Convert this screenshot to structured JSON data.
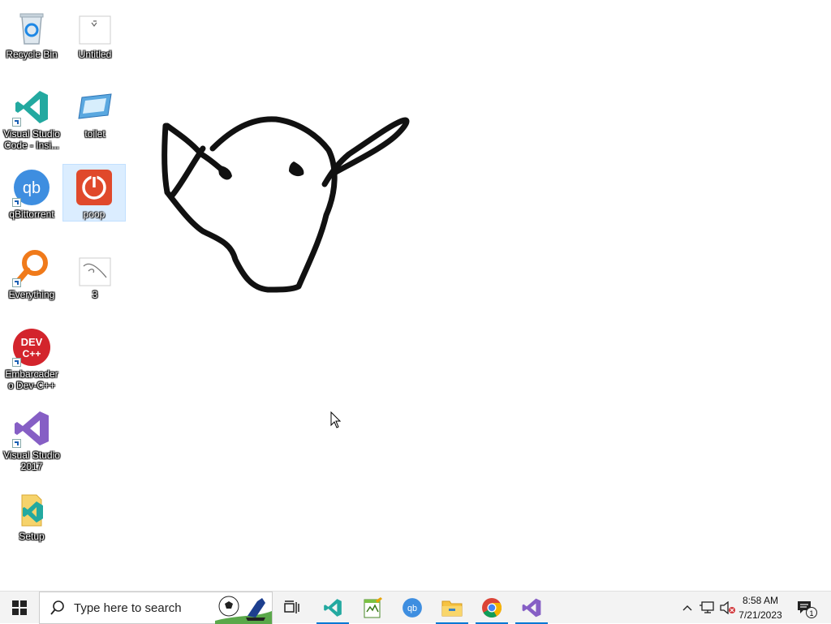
{
  "desktop": {
    "icons": [
      {
        "label": "Recycle Bin"
      },
      {
        "label": "Untitled"
      },
      {
        "label": "Visual Studio Code - Insi..."
      },
      {
        "label": "toilet"
      },
      {
        "label": "qBittorrent"
      },
      {
        "label": "poop"
      },
      {
        "label": "Everything"
      },
      {
        "label": "3"
      },
      {
        "label": "Embarcadero Dev-C++"
      },
      {
        "label": "Visual Studio 2017"
      },
      {
        "label": "Setup"
      }
    ],
    "selected_icon": "poop"
  },
  "taskbar": {
    "search_placeholder": "Type here to search",
    "pinned": [
      {
        "name": "task-view-icon"
      },
      {
        "name": "vscode-insiders-icon",
        "active": true
      },
      {
        "name": "notepad-plus-icon"
      },
      {
        "name": "qbittorrent-icon"
      },
      {
        "name": "file-explorer-icon",
        "active": true
      },
      {
        "name": "chrome-icon",
        "active": true
      },
      {
        "name": "visual-studio-icon",
        "active": true
      }
    ],
    "clock": {
      "time": "8:58 AM",
      "date": "7/21/2023"
    },
    "notification_count": "1"
  },
  "colors": {
    "taskbar_bg": "#f3f3f3",
    "accent": "#0078d4",
    "vscode_teal": "#23a9a0",
    "vs_purple": "#865fc5"
  }
}
